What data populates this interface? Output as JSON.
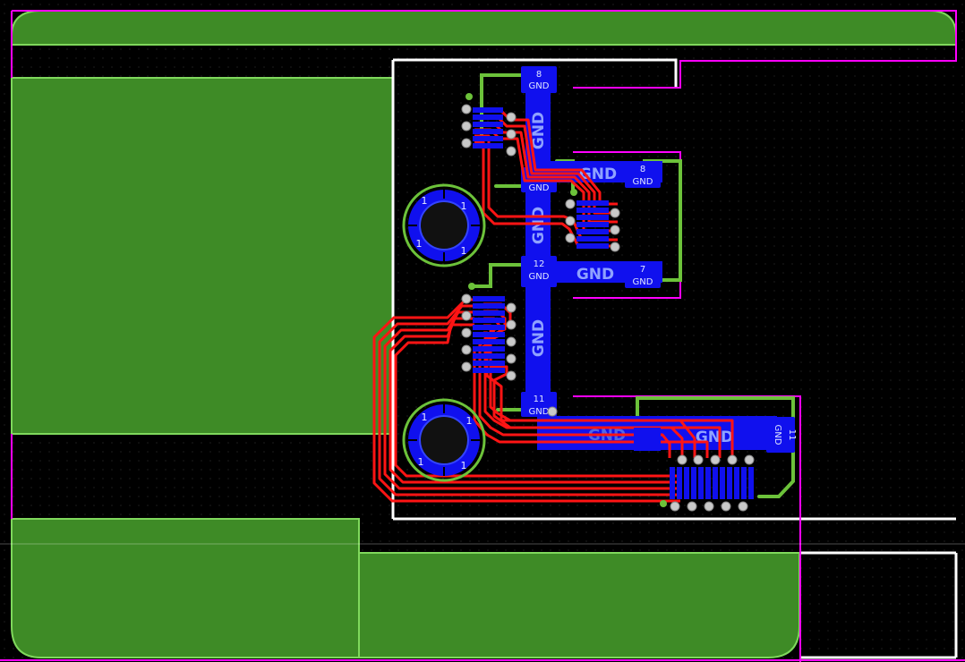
{
  "colors": {
    "background": "#000000",
    "copper_fill": "#3e8b26",
    "fill_outline": "#7fd85c",
    "keepout": "#ff00ff",
    "outline": "#ffffff",
    "pad_blue": "#1010ee",
    "trace_red": "#ff1414",
    "green_trace": "#6cc23a",
    "via": "#c9c9c9"
  },
  "pads": {
    "p8_top": {
      "num": "8",
      "net": "GND"
    },
    "p_mid": {
      "num": "",
      "net": "GND"
    },
    "p12": {
      "num": "12",
      "net": "GND"
    },
    "p11_left": {
      "num": "11",
      "net": "GND"
    },
    "p8_right": {
      "num": "8",
      "net": "GND"
    },
    "p7_right": {
      "num": "7",
      "net": "GND"
    },
    "p11_right": {
      "num": "11",
      "net": "GND"
    }
  },
  "net_labels": {
    "gnd1": "GND",
    "gnd2": "GND",
    "gnd3": "GND",
    "gnd4": "GND",
    "gnd5": "GND",
    "gnd6": "GND",
    "gnd7": "GND",
    "gnd8": "GND"
  },
  "mount_pins": {
    "upper": [
      "1",
      "1",
      "1",
      "1"
    ],
    "lower": [
      "1",
      "1",
      "1",
      "1"
    ]
  },
  "icons": {
    "mounting_hole": "mounting-hole-icon",
    "via": "via-icon"
  }
}
